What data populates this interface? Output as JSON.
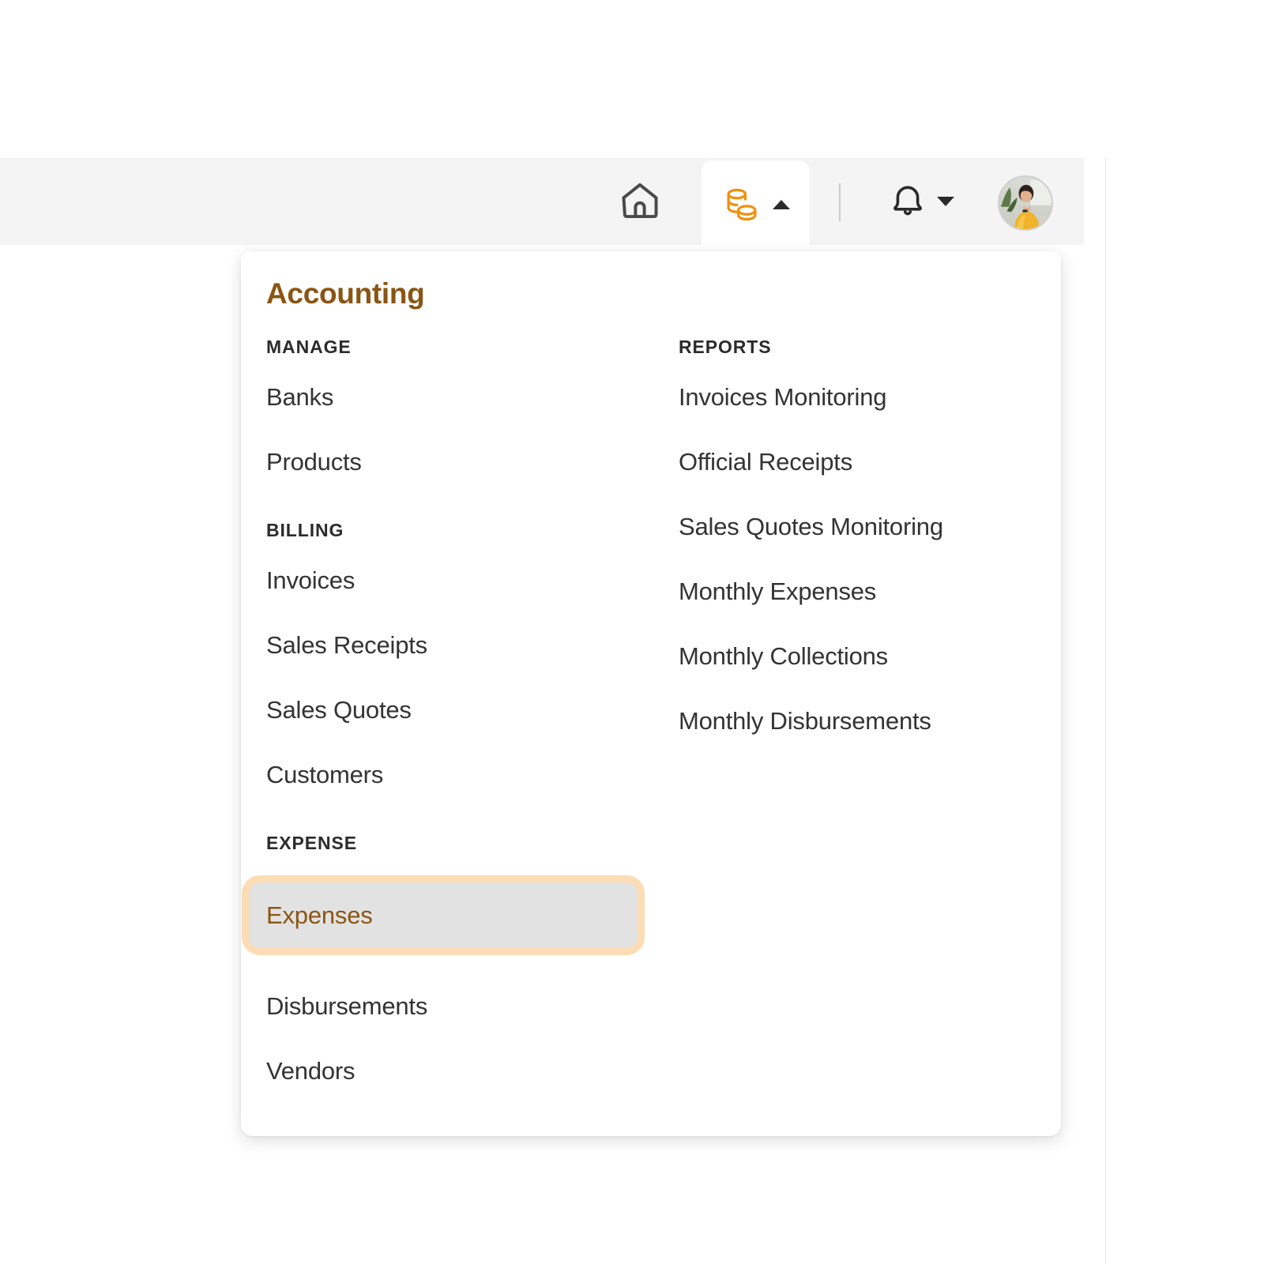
{
  "header": {
    "home_icon": "home-icon",
    "accounting_icon": "coins-icon",
    "accounting_caret": "caret-up-icon",
    "notifications_icon": "bell-icon",
    "notifications_caret": "caret-down-icon",
    "avatar_label": "user-avatar"
  },
  "dropdown": {
    "title": "Accounting",
    "columns": [
      {
        "groups": [
          {
            "label": "MANAGE",
            "items": [
              {
                "label": "Banks",
                "active": false
              },
              {
                "label": "Products",
                "active": false
              }
            ]
          },
          {
            "label": "BILLING",
            "items": [
              {
                "label": "Invoices",
                "active": false
              },
              {
                "label": "Sales Receipts",
                "active": false
              },
              {
                "label": "Sales Quotes",
                "active": false
              },
              {
                "label": "Customers",
                "active": false
              }
            ]
          },
          {
            "label": "EXPENSE",
            "items": [
              {
                "label": "Expenses",
                "active": true
              },
              {
                "label": "Disbursements",
                "active": false
              },
              {
                "label": "Vendors",
                "active": false
              }
            ]
          }
        ]
      },
      {
        "groups": [
          {
            "label": "REPORTS",
            "items": [
              {
                "label": "Invoices Monitoring",
                "active": false
              },
              {
                "label": "Official Receipts",
                "active": false
              },
              {
                "label": "Sales Quotes Monitoring",
                "active": false
              },
              {
                "label": "Monthly Expenses",
                "active": false
              },
              {
                "label": "Monthly Collections",
                "active": false
              },
              {
                "label": "Monthly Disbursements",
                "active": false
              }
            ]
          }
        ]
      }
    ]
  },
  "colors": {
    "brand_orange": "#F2900C",
    "brand_brown": "#8A5514",
    "header_bg": "#F4F4F4",
    "active_item_bg": "#E2E2E2",
    "active_item_ring": "#FBDCB4",
    "text_primary": "#333333"
  }
}
